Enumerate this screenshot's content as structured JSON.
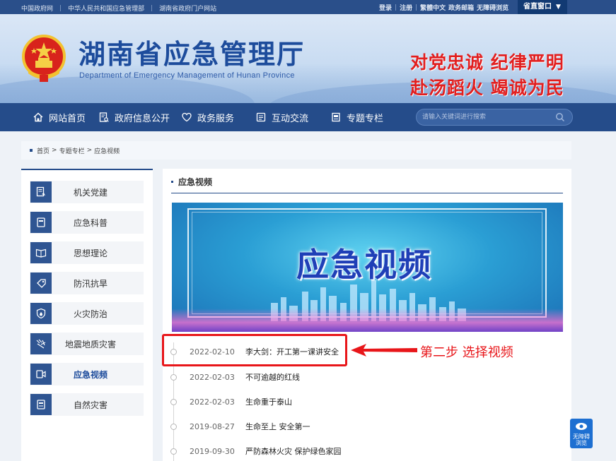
{
  "topbar": {
    "links_left": [
      "中国政府网",
      "中华人民共和国应急管理部",
      "湖南省政府门户网站"
    ],
    "links_right": [
      "登录",
      "注册",
      "繁體中文",
      "政务邮箱",
      "无障碍浏览"
    ],
    "region": "省直窗口",
    "region_caret": "▼"
  },
  "header": {
    "title": "湖南省应急管理厅",
    "subtitle": "Department of Emergency Management of Hunan Province",
    "slogan_1": "对党忠诚  纪律严明",
    "slogan_2": "赴汤蹈火  竭诚为民"
  },
  "nav": {
    "items": [
      {
        "label": "网站首页",
        "icon": "home-icon"
      },
      {
        "label": "政府信息公开",
        "icon": "document-search-icon"
      },
      {
        "label": "政务服务",
        "icon": "heart-shield-icon"
      },
      {
        "label": "互动交流",
        "icon": "chat-list-icon"
      },
      {
        "label": "专题专栏",
        "icon": "bookmark-doc-icon"
      }
    ],
    "search_placeholder": "请输入关键词进行搜索"
  },
  "breadcrumb": {
    "items": [
      "首页",
      "专题专栏",
      "应急视频"
    ],
    "separator": ">"
  },
  "sidebar": {
    "items": [
      {
        "label": "机关党建",
        "icon": "party-doc-icon"
      },
      {
        "label": "应急科普",
        "icon": "book-icon"
      },
      {
        "label": "思想理论",
        "icon": "open-book-icon"
      },
      {
        "label": "防汛抗旱",
        "icon": "water-tag-icon"
      },
      {
        "label": "火灾防治",
        "icon": "fire-shield-icon"
      },
      {
        "label": "地震地质灾害",
        "icon": "earthquake-icon"
      },
      {
        "label": "应急视频",
        "icon": "video-icon",
        "active": true
      },
      {
        "label": "自然灾害",
        "icon": "note-icon"
      }
    ]
  },
  "main": {
    "section_title": "应急视频",
    "banner_title": "应急视频",
    "list": [
      {
        "date": "2022-02-10",
        "title": "李大剑：开工第一课讲安全"
      },
      {
        "date": "2022-02-03",
        "title": "不可逾越的红线"
      },
      {
        "date": "2022-02-03",
        "title": "生命重于泰山"
      },
      {
        "date": "2019-08-27",
        "title": "生命至上 安全第一"
      },
      {
        "date": "2019-09-30",
        "title": "严防森林火灾 保护绿色家园"
      }
    ]
  },
  "annotation": {
    "text": "第二步 选择视频",
    "color": "#e8161a"
  },
  "accessibility": {
    "label_1": "无障碍",
    "label_2": "浏览"
  },
  "colors": {
    "primary": "#254c8a",
    "accent_red": "#e21f1f"
  }
}
